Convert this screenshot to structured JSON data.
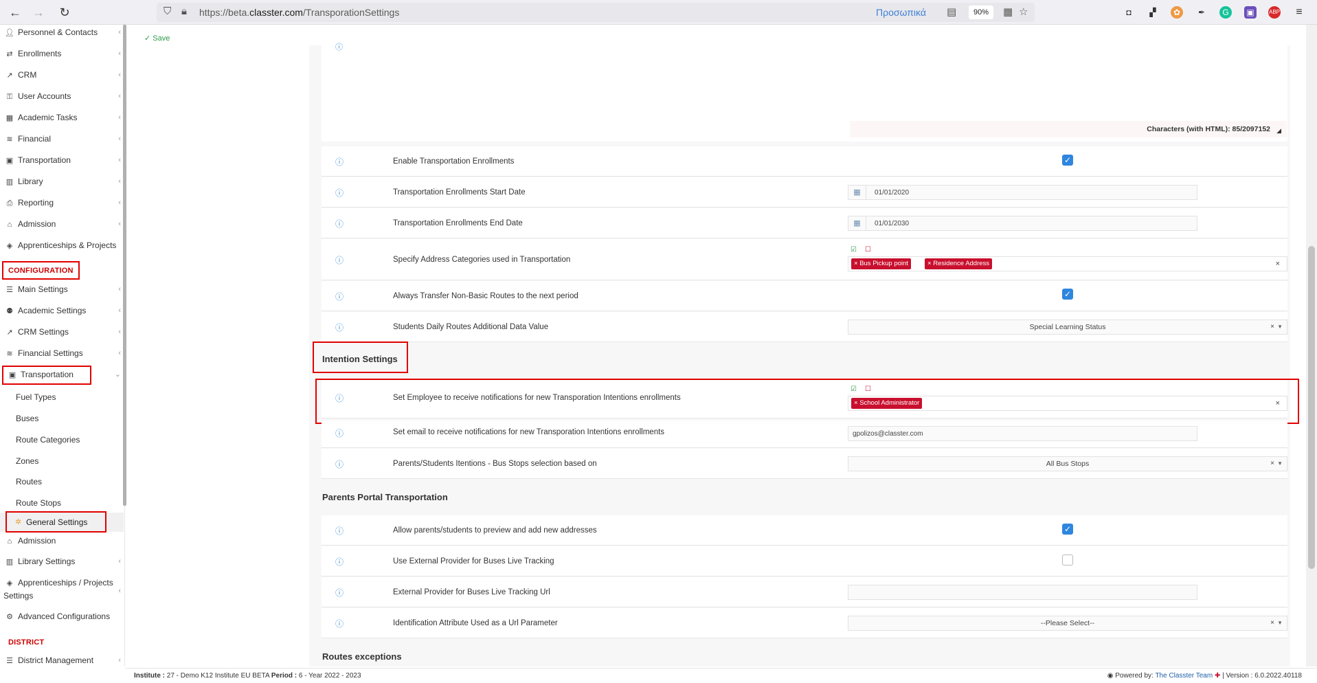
{
  "browser": {
    "url_prefix": "https://beta.",
    "url_host": "classter.com",
    "url_path": "/TransporationSettings",
    "profile": "Προσωπικά",
    "zoom": "90%"
  },
  "toolbar": {
    "save_label": "Save"
  },
  "sidebar": {
    "items": [
      {
        "label": "Personnel & Contacts"
      },
      {
        "label": "Enrollments"
      },
      {
        "label": "CRM"
      },
      {
        "label": "User Accounts"
      },
      {
        "label": "Academic Tasks"
      },
      {
        "label": "Financial"
      },
      {
        "label": "Transportation"
      },
      {
        "label": "Library"
      },
      {
        "label": "Reporting"
      },
      {
        "label": "Admission"
      },
      {
        "label": "Apprenticeships & Projects"
      }
    ],
    "config_heading": "CONFIGURATION",
    "config_items": [
      {
        "label": "Main Settings"
      },
      {
        "label": "Academic Settings"
      },
      {
        "label": "CRM Settings"
      },
      {
        "label": "Financial Settings"
      },
      {
        "label": "Transportation"
      }
    ],
    "transport_sub": [
      "Fuel Types",
      "Buses",
      "Route Categories",
      "Zones",
      "Routes",
      "Route Stops"
    ],
    "active_sub": "General Settings",
    "after_items": [
      {
        "label": "Admission"
      },
      {
        "label": "Library Settings"
      },
      {
        "label": "Apprenticeships / Projects"
      },
      {
        "label": "Advanced Configurations"
      }
    ],
    "apprenticeships_line2": "Settings",
    "district_heading": "DISTRICT",
    "district_items": [
      {
        "label": "District Management"
      }
    ]
  },
  "main": {
    "char_count": "Characters (with HTML): 85/2097152",
    "rows": [
      {
        "label": "Enable Transportation Enrollments"
      },
      {
        "label": "Transportation Enrollments Start Date",
        "value": "01/01/2020"
      },
      {
        "label": "Transportation Enrollments End Date",
        "value": "01/01/2030"
      },
      {
        "label": "Specify Address Categories used in Transportation",
        "tags": [
          "Bus Pickup point",
          "Residence Address"
        ]
      },
      {
        "label": "Always Transfer Non-Basic Routes to the next period"
      },
      {
        "label": "Students Daily Routes Additional Data Value",
        "value": "Special Learning Status"
      }
    ],
    "intention_title": "Intention Settings",
    "intention_rows": [
      {
        "label": "Set Employee to receive notifications for new Transporation Intentions enrollments",
        "tags": [
          "School Administrator"
        ]
      },
      {
        "label": "Set email to receive notifications for new Transporation Intentions enrollments",
        "value": "gpolizos@classter.com"
      },
      {
        "label": "Parents/Students Itentions - Bus Stops selection based on",
        "value": "All Bus Stops"
      }
    ],
    "portal_title": "Parents Portal Transportation",
    "portal_rows": [
      {
        "label": "Allow parents/students to preview and add new addresses"
      },
      {
        "label": "Use External Provider for Buses Live Tracking"
      },
      {
        "label": "External Provider for Buses Live Tracking Url",
        "value": ""
      },
      {
        "label": "Identification Attribute Used as a Url Parameter",
        "value": "--Please Select--"
      }
    ],
    "routes_title": "Routes exceptions"
  },
  "footer": {
    "institute_label": "Institute :",
    "institute_value": "27 - Demo K12 Institute EU BETA",
    "period_label": "Period :",
    "period_value": "6 - Year 2022 - 2023",
    "powered_label": "Powered by:",
    "powered_link": "The Classter Team",
    "version": "| Version : 6.0.2022.40118"
  },
  "colors": {
    "accent": "#2e86de",
    "tag_red": "#c8102e",
    "highlight_red": "#e10000",
    "save_green": "#2e9a4b",
    "info_blue": "#3b8fd6"
  }
}
